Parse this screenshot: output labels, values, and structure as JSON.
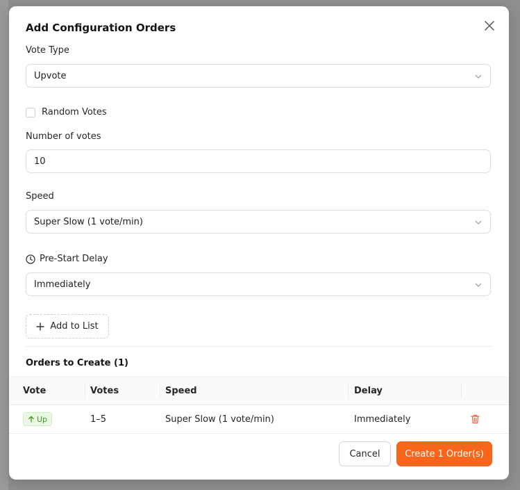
{
  "modal": {
    "title": "Add Configuration Orders",
    "close_icon": "close-icon"
  },
  "vote_type": {
    "label": "Vote Type",
    "value": "Upvote"
  },
  "random_votes": {
    "label": "Random Votes",
    "checked": false
  },
  "number_of_votes": {
    "label": "Number of votes",
    "value": "10"
  },
  "speed": {
    "label": "Speed",
    "value": "Super Slow (1 vote/min)"
  },
  "pre_start_delay": {
    "label": "Pre-Start Delay",
    "icon": "clock-icon",
    "value": "Immediately"
  },
  "add_to_list": {
    "label": "Add to List",
    "icon": "plus-icon"
  },
  "orders": {
    "title": "Orders to Create (1)",
    "columns": [
      "Vote",
      "Votes",
      "Speed",
      "Delay"
    ],
    "rows": [
      {
        "vote": "Up",
        "votes": "1–5",
        "speed": "Super Slow (1 vote/min)",
        "delay": "Immediately"
      }
    ]
  },
  "footer": {
    "cancel_label": "Cancel",
    "create_label": "Create 1 Order(s)"
  },
  "colors": {
    "accent": "#f9651b",
    "badge_green": "#3e9a1a",
    "delete_red": "#f25c3b"
  }
}
